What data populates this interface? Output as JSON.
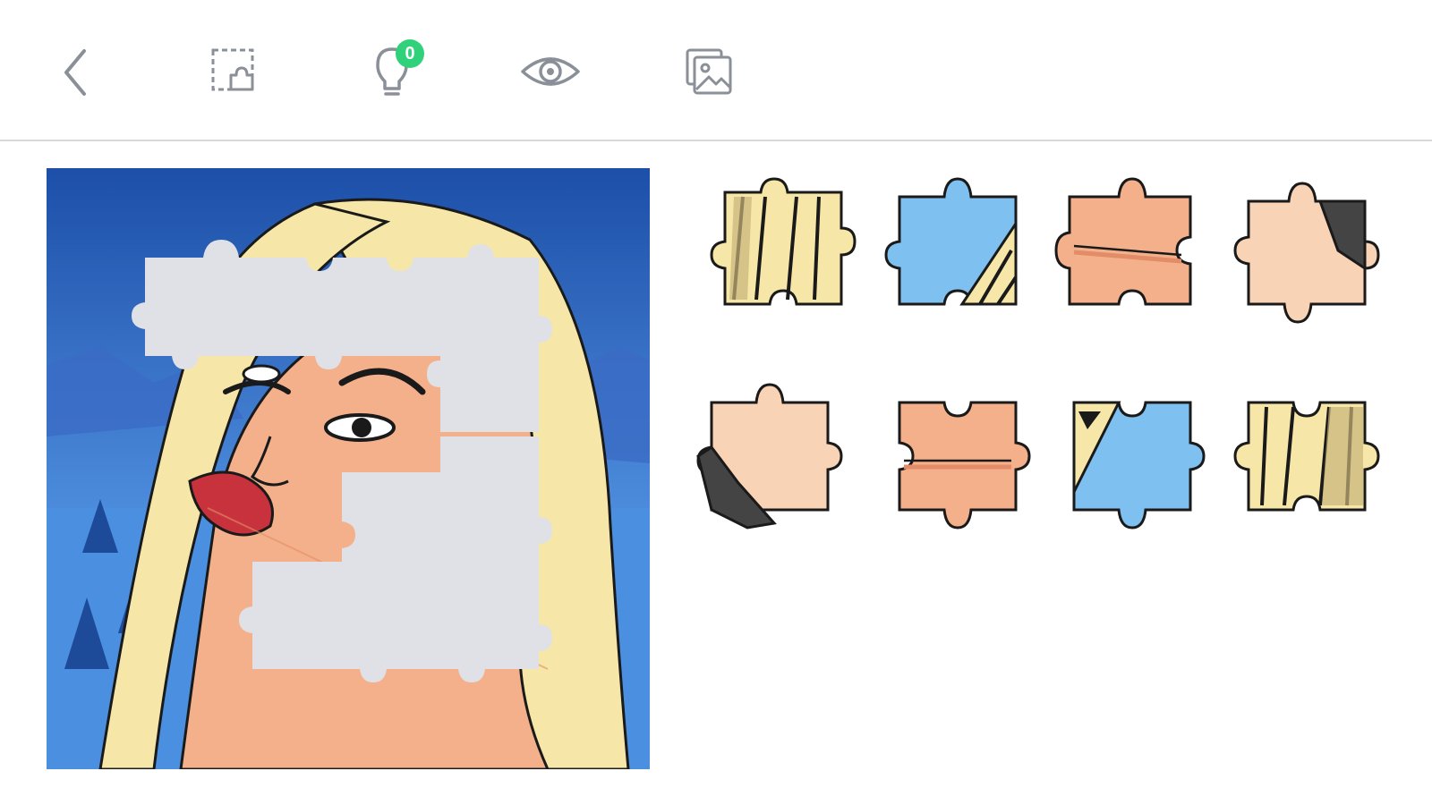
{
  "toolbar": {
    "hint_count": "0",
    "buttons": [
      {
        "name": "back-button",
        "icon": "chevron-left-icon"
      },
      {
        "name": "edge-pieces-button",
        "icon": "dashed-square-piece-icon"
      },
      {
        "name": "hint-button",
        "icon": "lightbulb-icon"
      },
      {
        "name": "preview-button",
        "icon": "eye-icon"
      },
      {
        "name": "background-button",
        "icon": "images-icon"
      }
    ]
  },
  "board": {
    "image": "woman-portrait-winter-illustration",
    "empty_slot_color": "#dfe1e6",
    "pieces_total": 16,
    "pieces_placed": 8
  },
  "tray": {
    "pieces": [
      {
        "name": "tray-piece-1",
        "art": "hair-strands"
      },
      {
        "name": "tray-piece-2",
        "art": "sky-hair"
      },
      {
        "name": "tray-piece-3",
        "art": "skin-lips"
      },
      {
        "name": "tray-piece-4",
        "art": "skin-hair-dark"
      },
      {
        "name": "tray-piece-5",
        "art": "skin-hair-dark"
      },
      {
        "name": "tray-piece-6",
        "art": "skin-lips"
      },
      {
        "name": "tray-piece-7",
        "art": "sky-hair"
      },
      {
        "name": "tray-piece-8",
        "art": "hair-strands"
      }
    ]
  },
  "colors": {
    "sky_top": "#1d4fa8",
    "sky_bottom": "#5aa8e8",
    "mountain": "#3b6cc4",
    "hair": "#f6e7a8",
    "hair_shadow": "#c9b37a",
    "skin": "#f4b08a",
    "skin_light": "#f9d3b5",
    "lips": "#c8323c",
    "outline": "#1a1a1a",
    "badge": "#2fd27a",
    "icon": "#8a8f98"
  }
}
